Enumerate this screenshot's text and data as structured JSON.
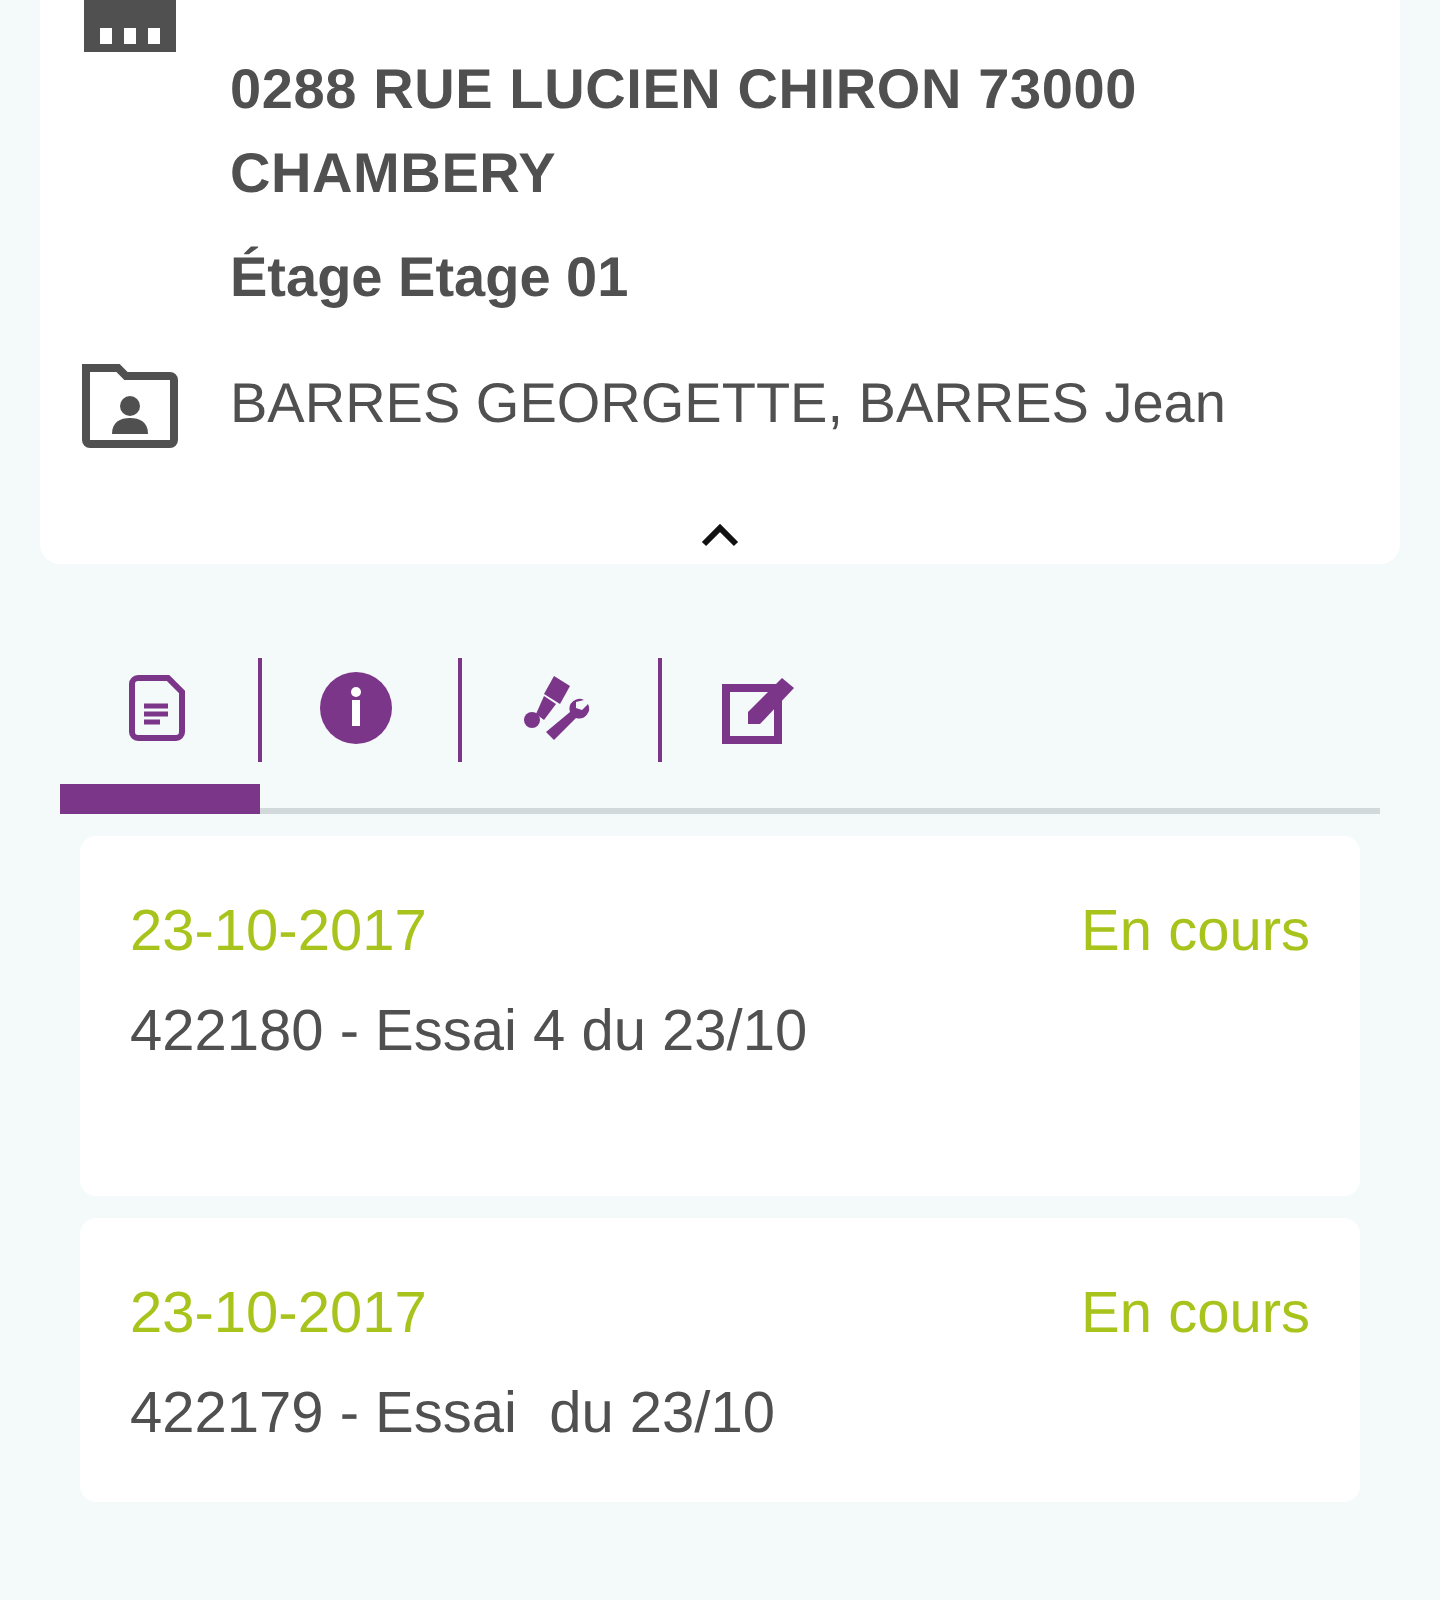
{
  "site": {
    "address": "0288 RUE LUCIEN CHIRON 73000 CHAMBERY",
    "floor": "Étage Etage 01",
    "occupants": "BARRES GEORGETTE, BARRES Jean",
    "expanded": true
  },
  "tabs": [
    {
      "kind": "document",
      "selected": true
    },
    {
      "kind": "info",
      "selected": false
    },
    {
      "kind": "tools",
      "selected": false
    },
    {
      "kind": "edit",
      "selected": false
    }
  ],
  "interventions": [
    {
      "date": "23-10-2017",
      "status": "En cours",
      "title": "422180 - Essai 4 du 23/10"
    },
    {
      "date": "23-10-2017",
      "status": "En cours",
      "title": "422179 - Essai  du 23/10"
    }
  ]
}
